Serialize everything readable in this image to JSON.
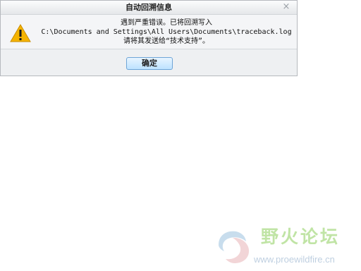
{
  "dialog": {
    "title": "自动回溯信息",
    "close_symbol": "×",
    "icon": "warning-icon",
    "message": {
      "line1": "遇到严重错误。已将回溯写入",
      "line2": "C:\\Documents and Settings\\All Users\\Documents\\traceback.log",
      "line3": "请将其发送给“技术支持”。"
    },
    "ok_label": "确定"
  },
  "watermark": {
    "title": "野火论坛",
    "url": "www.proewildfire.cn",
    "logo": "flame-swirl-logo"
  },
  "colors": {
    "warning_yellow": "#f5b400",
    "button_blue": "#bde2ff",
    "watermark_green": "#8ecf5c",
    "watermark_blue": "#8aa8c8"
  }
}
